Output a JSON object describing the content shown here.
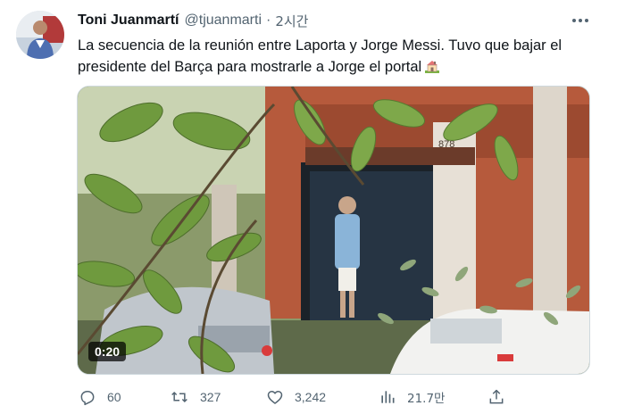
{
  "author": {
    "display_name": "Toni Juanmartí",
    "handle": "@tjuanmarti",
    "separator": "·",
    "time": "2시간"
  },
  "tweet": {
    "line1": "La secuencia de la reunión entre Laporta y Jorge Messi. Tuvo que bajar el",
    "line2": "presidente del Barça para mostrarle a Jorge el portal",
    "emoji_icon": "house-with-garden-icon"
  },
  "media": {
    "type": "video",
    "duration": "0:20",
    "sign_text": "878"
  },
  "actions": {
    "replies": "60",
    "retweets": "327",
    "likes": "3,242",
    "views": "21.7만"
  },
  "icons": {
    "more": "more-dots-icon",
    "reply": "reply-icon",
    "retweet": "retweet-icon",
    "like": "heart-icon",
    "views": "views-chart-icon",
    "share": "share-icon"
  },
  "colors": {
    "text_primary": "#0f1419",
    "text_secondary": "#536471",
    "border": "#cfd9de"
  }
}
